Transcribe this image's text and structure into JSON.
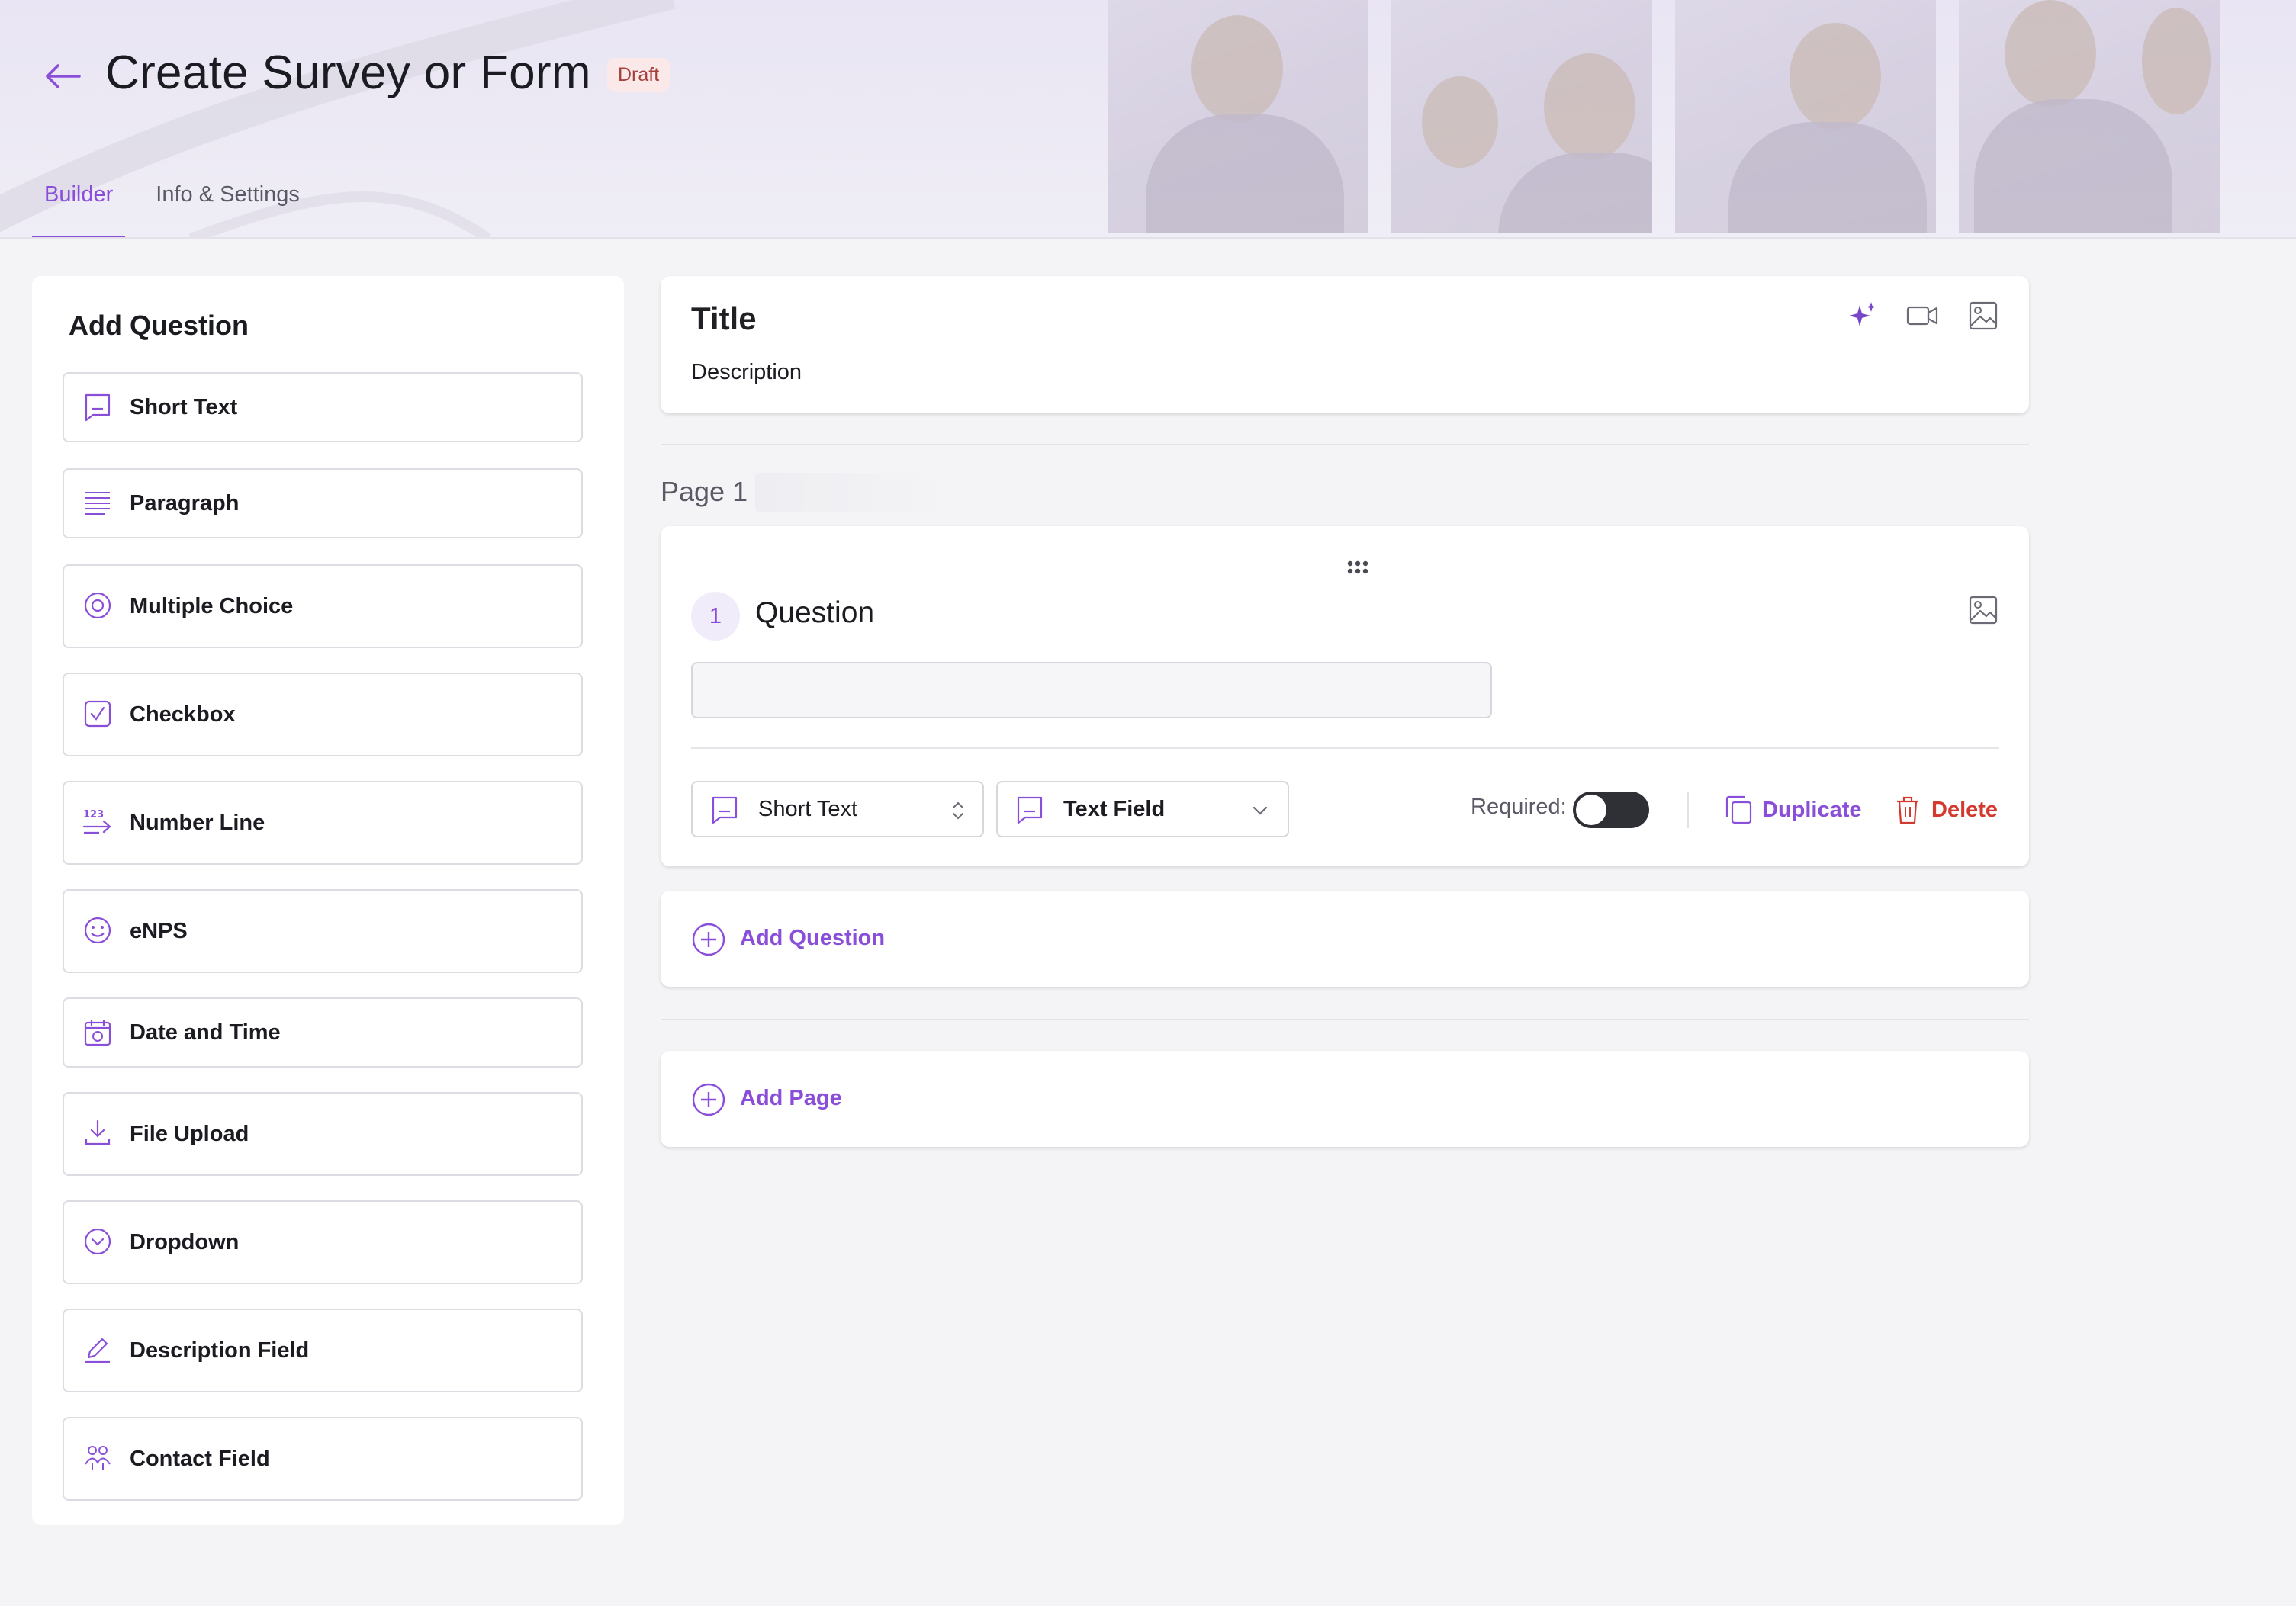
{
  "header": {
    "title": "Create Survey or Form",
    "badge": "Draft",
    "back_icon": "arrow-left-icon",
    "tabs": [
      {
        "label": "Builder",
        "active": true
      },
      {
        "label": "Info & Settings",
        "active": false
      }
    ]
  },
  "sidebar": {
    "heading": "Add Question",
    "items": [
      {
        "label": "Short Text",
        "icon": "short-text-icon"
      },
      {
        "label": "Paragraph",
        "icon": "paragraph-icon"
      },
      {
        "label": "Multiple Choice",
        "icon": "radio-icon"
      },
      {
        "label": "Checkbox",
        "icon": "checkbox-icon"
      },
      {
        "label": "Number Line",
        "icon": "number-line-icon"
      },
      {
        "label": "eNPS",
        "icon": "smiley-icon"
      },
      {
        "label": "Date and Time",
        "icon": "calendar-icon"
      },
      {
        "label": "File Upload",
        "icon": "upload-icon"
      },
      {
        "label": "Dropdown",
        "icon": "chevron-circle-icon"
      },
      {
        "label": "Description Field",
        "icon": "pencil-icon"
      },
      {
        "label": "Contact Field",
        "icon": "people-icon"
      }
    ]
  },
  "form": {
    "title": "Title",
    "description": "Description",
    "title_icons": [
      "sparkle-icon",
      "video-icon",
      "image-icon"
    ]
  },
  "page": {
    "label": "Page 1",
    "question": {
      "number": "1",
      "title": "Question",
      "answer_value": "",
      "type_select": "Short Text",
      "format_select": "Text Field",
      "required_label": "Required:",
      "required": false,
      "duplicate_label": "Duplicate",
      "delete_label": "Delete"
    },
    "add_question_label": "Add Question"
  },
  "add_page_label": "Add Page",
  "colors": {
    "accent": "#8a4fd9",
    "danger": "#d23a2f",
    "badge_bg": "#fbe9ea",
    "badge_text": "#a3423a"
  }
}
